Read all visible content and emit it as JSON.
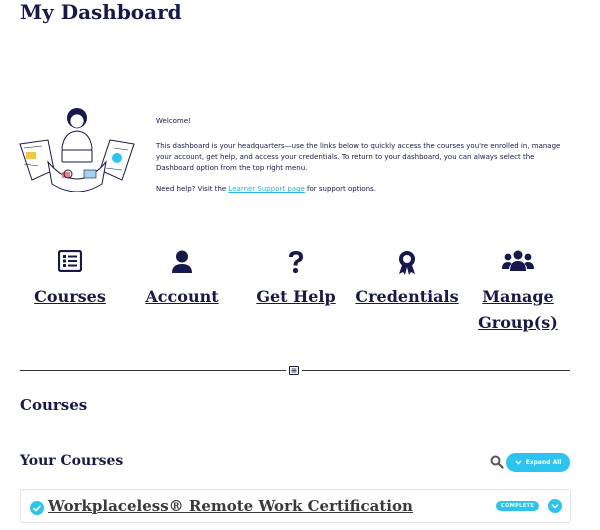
{
  "page": {
    "title": "My Dashboard"
  },
  "welcome": {
    "greeting": "Welcome!",
    "body": "This dashboard is your headquarters—use the links below to quickly access the courses you're enrolled in, manage your account, get help, and access your credentials. To return to your dashboard, you can always select the Dashboard option from the top right menu.",
    "help_prefix": "Need help? Visit the",
    "help_link": "Learner Support page",
    "help_suffix": " for support options."
  },
  "quick_links": [
    {
      "label": "Courses",
      "icon": "list-icon"
    },
    {
      "label": "Account",
      "icon": "user-icon"
    },
    {
      "label": "Get Help",
      "icon": "question-icon"
    },
    {
      "label": "Credentials",
      "icon": "award-icon"
    },
    {
      "label": "Manage Group(s)",
      "label_line1": "Manage",
      "label_line2": "Group(s)",
      "icon": "users-icon"
    }
  ],
  "sections": {
    "courses_title": "Courses",
    "your_courses_title": "Your Courses"
  },
  "controls": {
    "expand_all": "Expand All",
    "search_icon": "search-icon"
  },
  "courses": [
    {
      "title": "Workplaceless® Remote Work Certification",
      "status": "COMPLETE"
    }
  ],
  "colors": {
    "navy": "#17184b",
    "accent": "#2cc3ef",
    "link": "#27b5e8"
  }
}
